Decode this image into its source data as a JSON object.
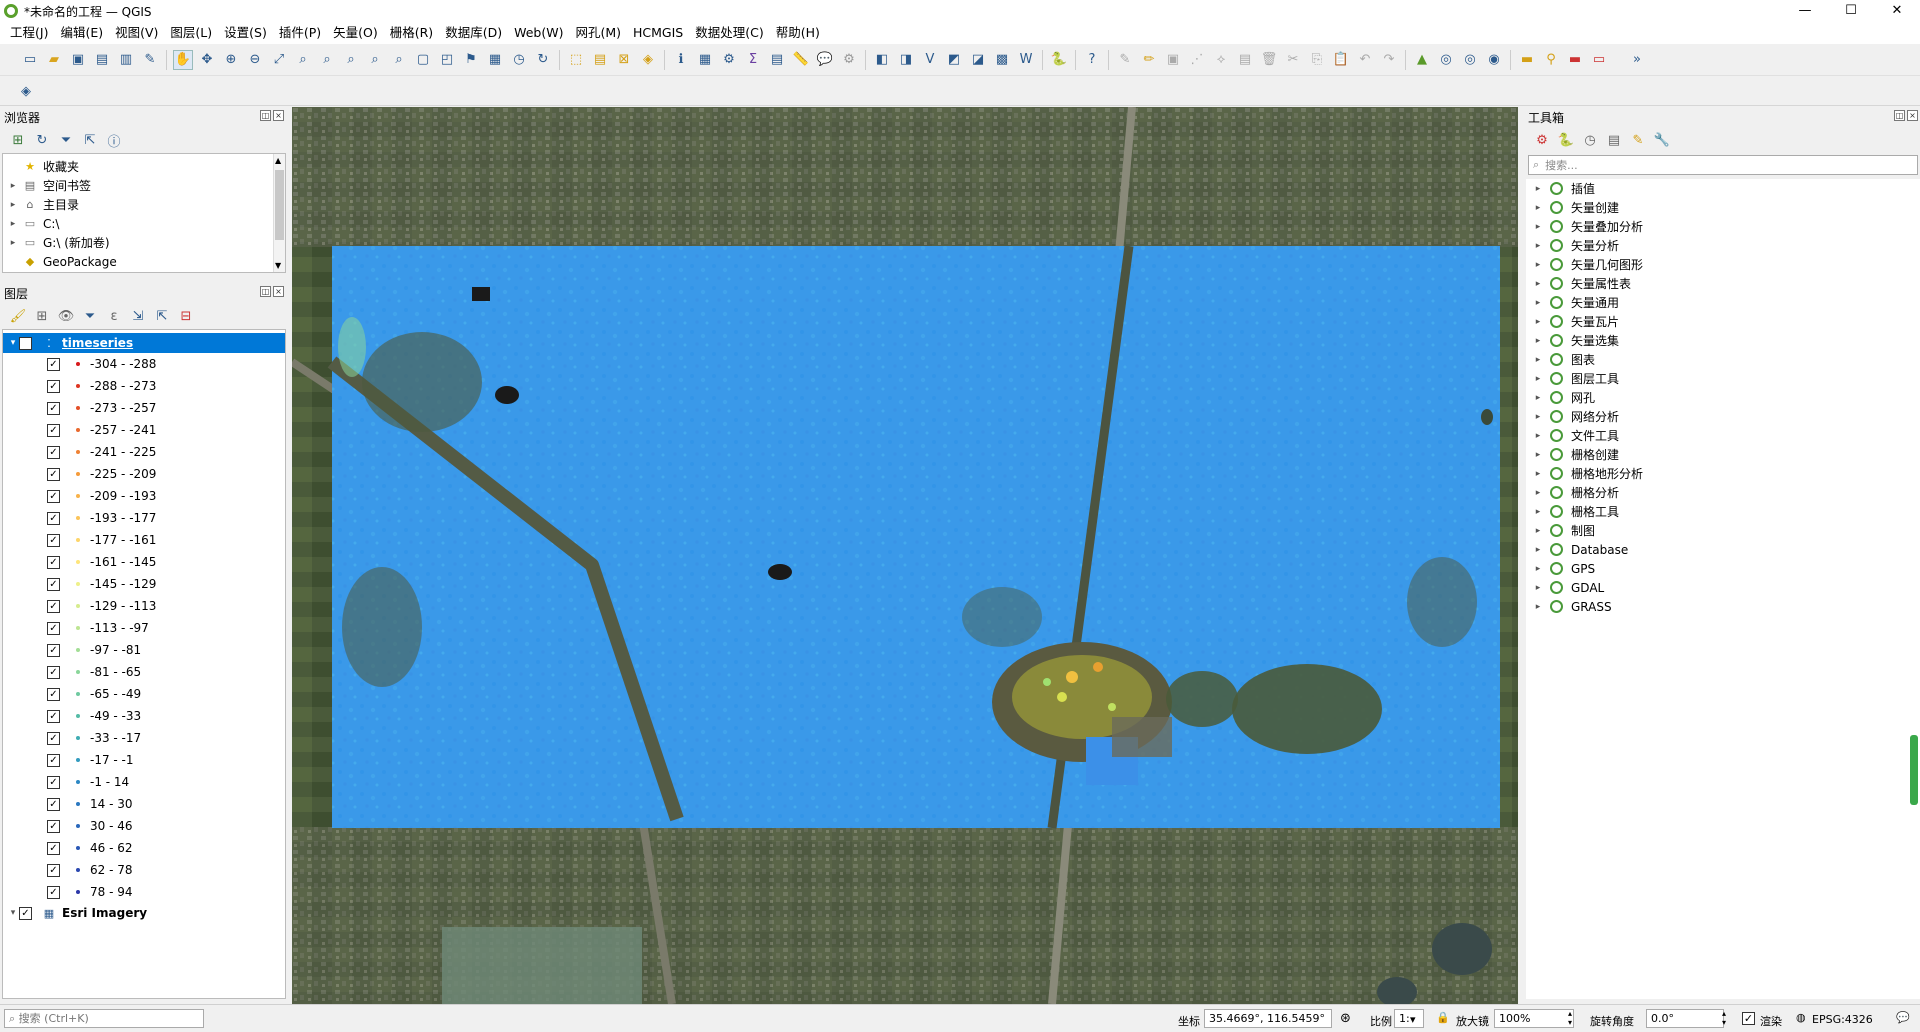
{
  "window": {
    "title": "*未命名的工程 — QGIS",
    "min": "—",
    "max": "☐",
    "close": "✕"
  },
  "menu": [
    "工程(J)",
    "编辑(E)",
    "视图(V)",
    "图层(L)",
    "设置(S)",
    "插件(P)",
    "矢量(O)",
    "栅格(R)",
    "数据库(D)",
    "Web(W)",
    "网孔(M)",
    "HCMGIS",
    "数据处理(C)",
    "帮助(H)"
  ],
  "browser": {
    "title": "浏览器",
    "items": [
      {
        "label": "收藏夹",
        "icon": "star-icon",
        "arrow": ""
      },
      {
        "label": "空间书签",
        "icon": "bookmark-icon",
        "arrow": "▸"
      },
      {
        "label": "主目录",
        "icon": "home-folder-icon",
        "arrow": "▸"
      },
      {
        "label": "C:\\",
        "icon": "drive-icon",
        "arrow": "▸"
      },
      {
        "label": "G:\\ (新加卷)",
        "icon": "drive-icon",
        "arrow": "▸"
      },
      {
        "label": "GeoPackage",
        "icon": "geopackage-icon",
        "arrow": ""
      }
    ]
  },
  "layers": {
    "title": "图层",
    "timeseries_label": "timeseries",
    "ranges": [
      {
        "label": "-304 - -288",
        "color": "#d7191c"
      },
      {
        "label": "-288 - -273",
        "color": "#dd3522"
      },
      {
        "label": "-273 - -257",
        "color": "#e34f28"
      },
      {
        "label": "-257 - -241",
        "color": "#e9692e"
      },
      {
        "label": "-241 - -225",
        "color": "#ef8234"
      },
      {
        "label": "-225 - -209",
        "color": "#f59b3b"
      },
      {
        "label": "-209 - -193",
        "color": "#f8b24a"
      },
      {
        "label": "-193 - -177",
        "color": "#fbc45a"
      },
      {
        "label": "-177 - -161",
        "color": "#fdd56a"
      },
      {
        "label": "-161 - -145",
        "color": "#fee57b"
      },
      {
        "label": "-145 - -129",
        "color": "#eef08a"
      },
      {
        "label": "-129 - -113",
        "color": "#d6ec8e"
      },
      {
        "label": "-113 - -97",
        "color": "#bde592"
      },
      {
        "label": "-97 - -81",
        "color": "#a3de96"
      },
      {
        "label": "-81 - -65",
        "color": "#8ad69a"
      },
      {
        "label": "-65 - -49",
        "color": "#6fc9a0"
      },
      {
        "label": "-49 - -33",
        "color": "#55bba6"
      },
      {
        "label": "-33 - -17",
        "color": "#3facb3"
      },
      {
        "label": "-17 - -1",
        "color": "#339bbf"
      },
      {
        "label": "-1 - 14",
        "color": "#2c88c4"
      },
      {
        "label": "14 - 30",
        "color": "#2b78c0"
      },
      {
        "label": "30 - 46",
        "color": "#2a68bb"
      },
      {
        "label": "46 - 62",
        "color": "#2a58b6"
      },
      {
        "label": "62 - 78",
        "color": "#2b48b0"
      },
      {
        "label": "78 - 94",
        "color": "#2c38a8"
      }
    ],
    "esri_label": "Esri Imagery"
  },
  "toolbox": {
    "title": "工具箱",
    "search_placeholder": "搜索...",
    "items": [
      "插值",
      "矢量创建",
      "矢量叠加分析",
      "矢量分析",
      "矢量几何图形",
      "矢量属性表",
      "矢量通用",
      "矢量瓦片",
      "矢量选集",
      "图表",
      "图层工具",
      "网孔",
      "网络分析",
      "文件工具",
      "栅格创建",
      "栅格地形分析",
      "栅格分析",
      "栅格工具",
      "制图",
      "Database",
      "GPS",
      "GDAL",
      "GRASS"
    ]
  },
  "status": {
    "search_placeholder": "搜索 (Ctrl+K)",
    "coord_label": "坐标",
    "coord_value": "35.4669°, 116.5459°",
    "scale_label": "比例",
    "scale_value": "1:",
    "magnifier_label": "放大镜",
    "magnifier_value": "100%",
    "rotation_label": "旋转角度",
    "rotation_value": "0.0°",
    "render_label": "渲染",
    "crs": "EPSG:4326"
  }
}
